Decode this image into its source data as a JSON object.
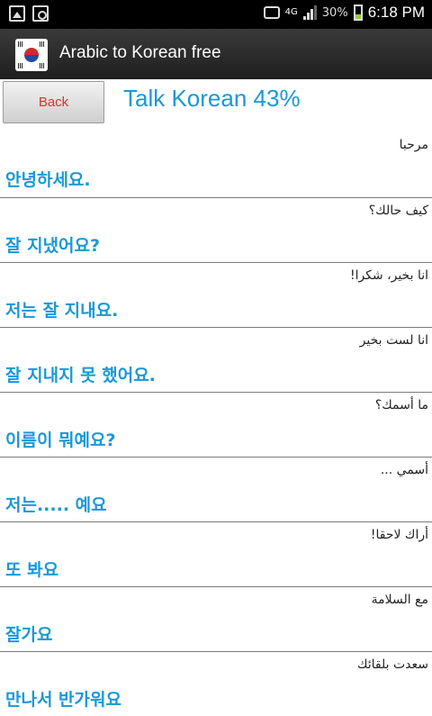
{
  "status_bar": {
    "network": "4G",
    "battery_percent": "30%",
    "time": "6:18 PM"
  },
  "app_bar": {
    "title": "Arabic to Korean free",
    "icon": "korean-flag-icon"
  },
  "header": {
    "back_label": "Back",
    "title": "Talk Korean 43%"
  },
  "phrases": [
    {
      "arabic": "مرحبا",
      "korean": "안녕하세요."
    },
    {
      "arabic": "كيف حالك؟",
      "korean": "잘 지냈어요?"
    },
    {
      "arabic": "انا بخير، شكرا!",
      "korean": "저는 잘 지내요."
    },
    {
      "arabic": "انا لست بخير",
      "korean": "잘 지내지 못 했어요."
    },
    {
      "arabic": "ما أسمك؟",
      "korean": "이름이 뭐예요?"
    },
    {
      "arabic": "أسمي ...",
      "korean": "저는..... 예요"
    },
    {
      "arabic": "أراك لاحقا!",
      "korean": "또 봐요"
    },
    {
      "arabic": "مع السلامة",
      "korean": "잘가요"
    },
    {
      "arabic": "سعدت بلقائك",
      "korean": "만나서 반가워요"
    }
  ],
  "colors": {
    "accent": "#1a98d5",
    "back_text": "#e0312a",
    "app_bar": "#2a2a2a"
  }
}
